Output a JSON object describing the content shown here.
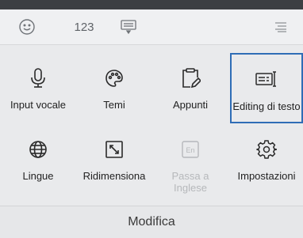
{
  "toolbar": {
    "emoji_icon": "smiley-icon",
    "numbers_label": "123",
    "clipboard_icon": "clipboard-keyboard-icon",
    "menu_icon": "menu-lines-icon"
  },
  "menu": {
    "items": [
      {
        "label": "Input vocale",
        "icon": "microphone-icon",
        "state": "normal"
      },
      {
        "label": "Temi",
        "icon": "palette-icon",
        "state": "normal"
      },
      {
        "label": "Appunti",
        "icon": "clipboard-edit-icon",
        "state": "normal"
      },
      {
        "label": "Editing di testo",
        "icon": "text-editing-icon",
        "state": "selected"
      },
      {
        "label": "Lingue",
        "icon": "globe-icon",
        "state": "normal"
      },
      {
        "label": "Ridimensiona",
        "icon": "resize-icon",
        "state": "normal"
      },
      {
        "label": "Passa a\nInglese",
        "label_line1": "Passa a",
        "label_line2": "Inglese",
        "icon": "en-keyboard-icon",
        "state": "disabled"
      },
      {
        "label": "Impostazioni",
        "icon": "gear-icon",
        "state": "normal"
      }
    ]
  },
  "footer": {
    "label": "Modifica"
  },
  "colors": {
    "selection_border": "#2f6db6",
    "background": "#e9eaec",
    "disabled_text": "#b6b8bb"
  }
}
